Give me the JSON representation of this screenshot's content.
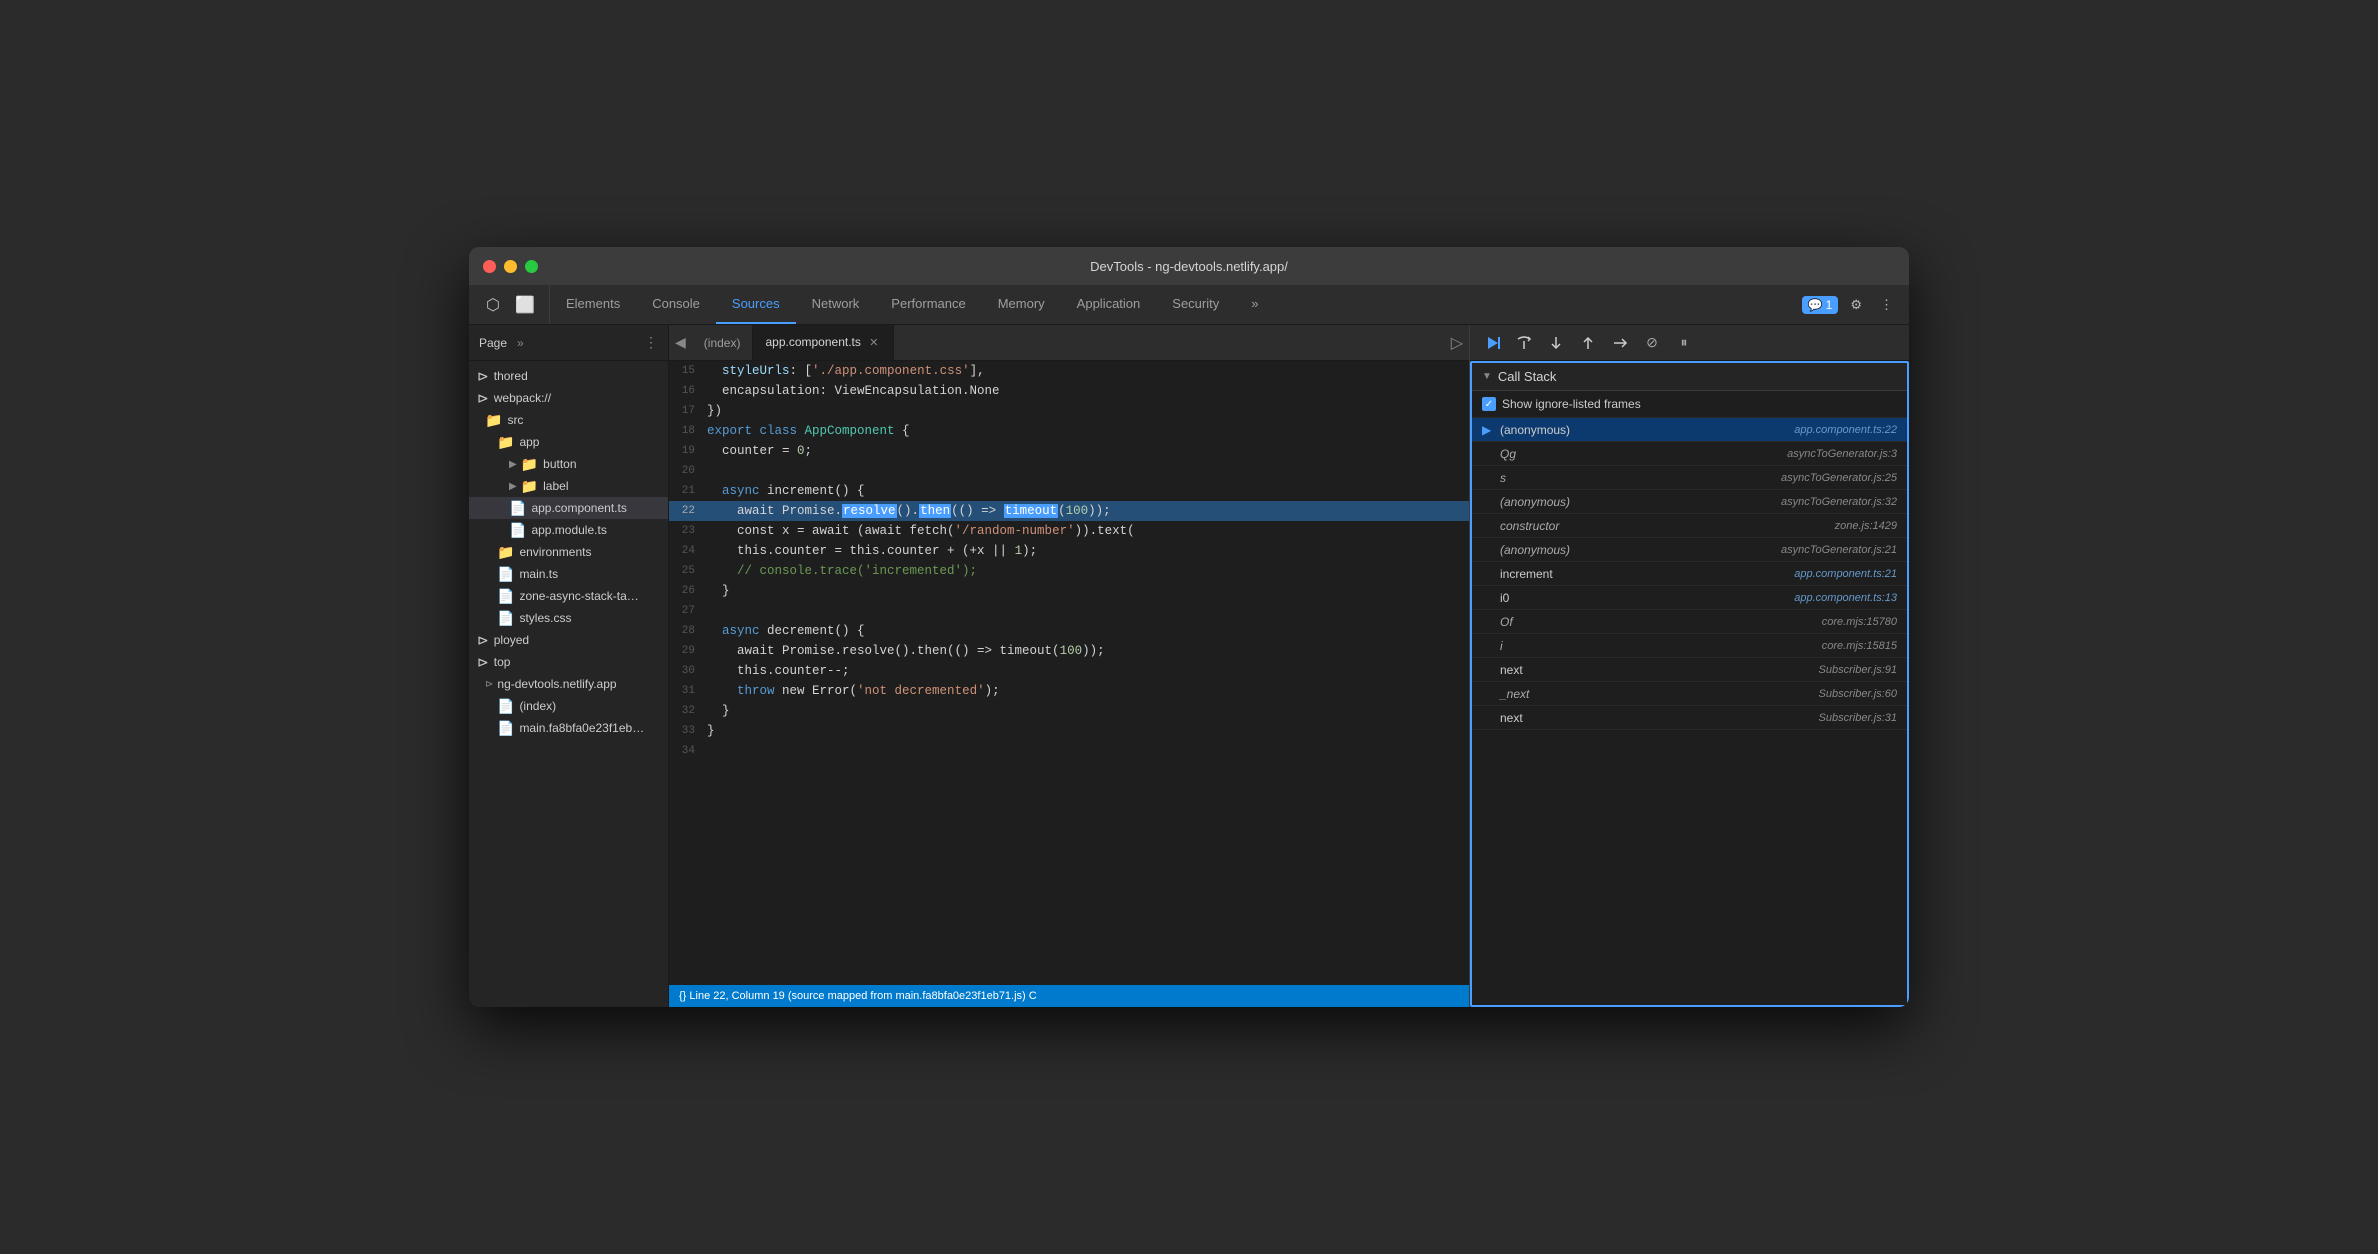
{
  "window": {
    "title": "DevTools - ng-devtools.netlify.app/"
  },
  "toolbar": {
    "tabs": [
      {
        "label": "Elements",
        "active": false
      },
      {
        "label": "Console",
        "active": false
      },
      {
        "label": "Sources",
        "active": true
      },
      {
        "label": "Network",
        "active": false
      },
      {
        "label": "Performance",
        "active": false
      },
      {
        "label": "Memory",
        "active": false
      },
      {
        "label": "Application",
        "active": false
      },
      {
        "label": "Security",
        "active": false
      }
    ],
    "more_label": "»",
    "notification_count": "1",
    "settings_label": "⚙",
    "more_menu_label": "⋮"
  },
  "file_tree": {
    "header_label": "Page",
    "items": [
      {
        "label": "thored",
        "indent": 0,
        "type": "text"
      },
      {
        "label": "webpack://",
        "indent": 0,
        "type": "text"
      },
      {
        "label": "src",
        "indent": 1,
        "type": "folder",
        "color": "orange"
      },
      {
        "label": "app",
        "indent": 2,
        "type": "folder",
        "color": "orange"
      },
      {
        "label": "button",
        "indent": 3,
        "type": "folder",
        "color": "orange"
      },
      {
        "label": "label",
        "indent": 3,
        "type": "folder",
        "color": "orange"
      },
      {
        "label": "app.component.ts",
        "indent": 3,
        "type": "file",
        "color": "gray",
        "selected": true
      },
      {
        "label": "app.module.ts",
        "indent": 3,
        "type": "file",
        "color": "gray"
      },
      {
        "label": "environments",
        "indent": 2,
        "type": "folder",
        "color": "orange"
      },
      {
        "label": "main.ts",
        "indent": 2,
        "type": "file",
        "color": "gray"
      },
      {
        "label": "zone-async-stack-ta…",
        "indent": 2,
        "type": "file",
        "color": "gray"
      },
      {
        "label": "styles.css",
        "indent": 2,
        "type": "file",
        "color": "purple"
      },
      {
        "label": "ployed",
        "indent": 0,
        "type": "text"
      },
      {
        "label": "top",
        "indent": 0,
        "type": "text"
      },
      {
        "label": "ng-devtools.netlify.app",
        "indent": 1,
        "type": "domain"
      },
      {
        "label": "(index)",
        "indent": 2,
        "type": "file",
        "color": "gray"
      },
      {
        "label": "main.fa8bfa0e23f1eb…",
        "indent": 2,
        "type": "file",
        "color": "gray"
      }
    ]
  },
  "editor": {
    "tabs": [
      {
        "label": "(index)",
        "active": false
      },
      {
        "label": "app.component.ts",
        "active": true,
        "closeable": true
      }
    ],
    "lines": [
      {
        "num": "15",
        "tokens": [
          {
            "text": "  styleUrls: ['./app.component.css'],",
            "class": "c-string"
          }
        ]
      },
      {
        "num": "16",
        "tokens": [
          {
            "text": "  encapsulation: ViewEncapsulation.None",
            "class": ""
          }
        ]
      },
      {
        "num": "17",
        "tokens": [
          {
            "text": "})",
            "class": ""
          }
        ]
      },
      {
        "num": "18",
        "tokens": [
          {
            "text": "export class ",
            "class": "c-keyword"
          },
          {
            "text": "AppComponent",
            "class": "c-class"
          },
          {
            "text": " {",
            "class": ""
          }
        ]
      },
      {
        "num": "19",
        "tokens": [
          {
            "text": "  counter = ",
            "class": ""
          },
          {
            "text": "0",
            "class": "c-number"
          },
          {
            "text": ";",
            "class": ""
          }
        ]
      },
      {
        "num": "20",
        "tokens": []
      },
      {
        "num": "21",
        "tokens": [
          {
            "text": "  ",
            "class": ""
          },
          {
            "text": "async",
            "class": "c-keyword"
          },
          {
            "text": " increment() {",
            "class": ""
          }
        ]
      },
      {
        "num": "22",
        "tokens": [
          {
            "text": "    await Promise.",
            "class": ""
          },
          {
            "text": "resolve",
            "class": "c-func"
          },
          {
            "text": "().",
            "class": ""
          },
          {
            "text": "then",
            "class": "c-func"
          },
          {
            "text": "(() => ",
            "class": ""
          },
          {
            "text": "timeout",
            "class": "c-func"
          },
          {
            "text": "(",
            "class": ""
          },
          {
            "text": "100",
            "class": "c-number"
          },
          {
            "text": "));",
            "class": ""
          }
        ],
        "highlighted": true
      },
      {
        "num": "23",
        "tokens": [
          {
            "text": "    const x = await (await fetch('/random-number')).text(",
            "class": ""
          }
        ]
      },
      {
        "num": "24",
        "tokens": [
          {
            "text": "    this.counter = this.counter + (+x || ",
            "class": ""
          },
          {
            "text": "1",
            "class": "c-number"
          },
          {
            "text": ");",
            "class": ""
          }
        ]
      },
      {
        "num": "25",
        "tokens": [
          {
            "text": "    ",
            "class": ""
          },
          {
            "text": "// console.trace('incremented');",
            "class": "c-comment"
          }
        ]
      },
      {
        "num": "26",
        "tokens": [
          {
            "text": "  }",
            "class": ""
          }
        ]
      },
      {
        "num": "27",
        "tokens": []
      },
      {
        "num": "28",
        "tokens": [
          {
            "text": "  ",
            "class": ""
          },
          {
            "text": "async",
            "class": "c-keyword"
          },
          {
            "text": " decrement() {",
            "class": ""
          }
        ]
      },
      {
        "num": "29",
        "tokens": [
          {
            "text": "    await Promise.resolve().then(() => timeout(",
            "class": ""
          },
          {
            "text": "100",
            "class": "c-number"
          },
          {
            "text": "));",
            "class": ""
          }
        ]
      },
      {
        "num": "30",
        "tokens": [
          {
            "text": "    this.counter--;",
            "class": ""
          }
        ]
      },
      {
        "num": "31",
        "tokens": [
          {
            "text": "    ",
            "class": ""
          },
          {
            "text": "throw",
            "class": "c-keyword"
          },
          {
            "text": " new Error('not decremented');",
            "class": ""
          }
        ]
      },
      {
        "num": "32",
        "tokens": [
          {
            "text": "  }",
            "class": ""
          }
        ]
      },
      {
        "num": "33",
        "tokens": [
          {
            "text": "}",
            "class": ""
          }
        ]
      },
      {
        "num": "34",
        "tokens": []
      }
    ]
  },
  "status_bar": {
    "text": "{} Line 22, Column 19 (source mapped from main.fa8bfa0e23f1eb71.js) C"
  },
  "debugger": {
    "buttons": [
      {
        "label": "▶",
        "title": "Resume",
        "active": true
      },
      {
        "label": "↺",
        "title": "Step over"
      },
      {
        "label": "↓",
        "title": "Step into"
      },
      {
        "label": "↑",
        "title": "Step out"
      },
      {
        "label": "⇄",
        "title": "Step"
      },
      {
        "label": "⊘",
        "title": "Deactivate breakpoints"
      },
      {
        "label": "⏸",
        "title": "Pause on exceptions"
      }
    ]
  },
  "call_stack": {
    "header_label": "Call Stack",
    "show_ignore_label": "Show ignore-listed frames",
    "items": [
      {
        "name": "(anonymous)",
        "location": "app.component.ts:22",
        "active": true,
        "italic": false
      },
      {
        "name": "Qg",
        "location": "asyncToGenerator.js:3",
        "active": false,
        "italic": true
      },
      {
        "name": "s",
        "location": "asyncToGenerator.js:25",
        "active": false,
        "italic": true
      },
      {
        "name": "(anonymous)",
        "location": "asyncToGenerator.js:32",
        "active": false,
        "italic": true
      },
      {
        "name": "constructor",
        "location": "zone.js:1429",
        "active": false,
        "italic": true
      },
      {
        "name": "(anonymous)",
        "location": "asyncToGenerator.js:21",
        "active": false,
        "italic": true
      },
      {
        "name": "increment",
        "location": "app.component.ts:21",
        "active": false,
        "italic": false
      },
      {
        "name": "i0",
        "location": "app.component.ts:13",
        "active": false,
        "italic": false
      },
      {
        "name": "Of",
        "location": "core.mjs:15780",
        "active": false,
        "italic": true
      },
      {
        "name": "i",
        "location": "core.mjs:15815",
        "active": false,
        "italic": true
      },
      {
        "name": "next",
        "location": "Subscriber.js:91",
        "active": false,
        "italic": false
      },
      {
        "name": "_next",
        "location": "Subscriber.js:60",
        "active": false,
        "italic": true
      },
      {
        "name": "next",
        "location": "Subscriber.js:31",
        "active": false,
        "italic": false
      }
    ]
  }
}
